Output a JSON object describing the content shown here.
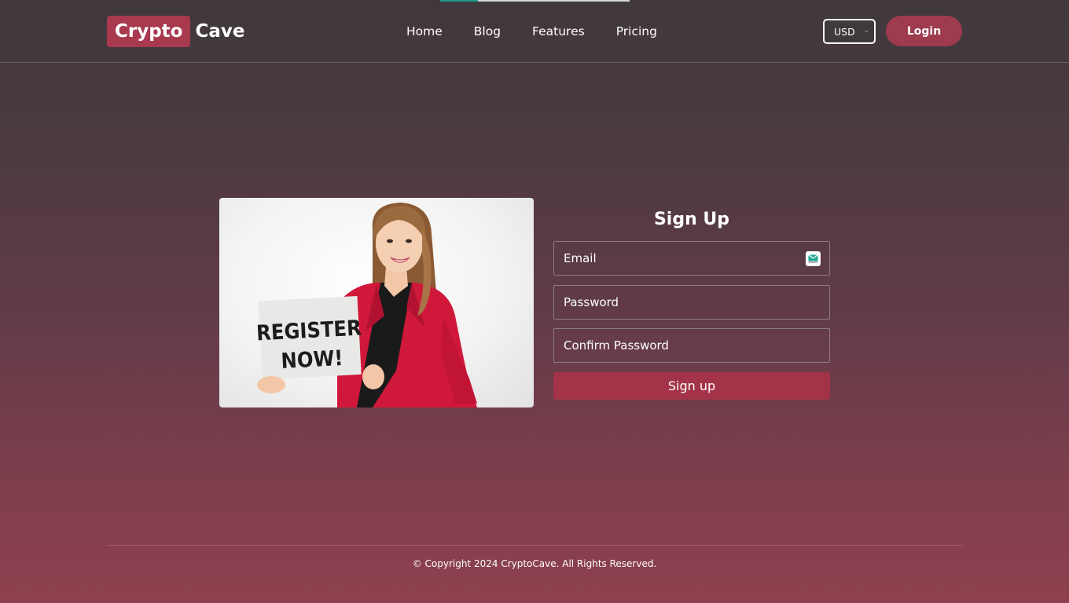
{
  "header": {
    "logo_part1": "Crypto",
    "logo_part2": "Cave",
    "nav": [
      "Home",
      "Blog",
      "Features",
      "Pricing"
    ],
    "currency": "USD",
    "login_label": "Login"
  },
  "hero": {
    "sign_line1": "REGISTER",
    "sign_line2": "NOW!"
  },
  "signup": {
    "title": "Sign Up",
    "email_placeholder": "Email",
    "password_placeholder": "Password",
    "confirm_placeholder": "Confirm Password",
    "button_label": "Sign up"
  },
  "footer": {
    "copyright": "© Copyright 2024 CryptoCave. All Rights Reserved."
  },
  "colors": {
    "brand": "#a8394e",
    "button": "#a33348",
    "accent_teal": "#1a9a8c"
  }
}
